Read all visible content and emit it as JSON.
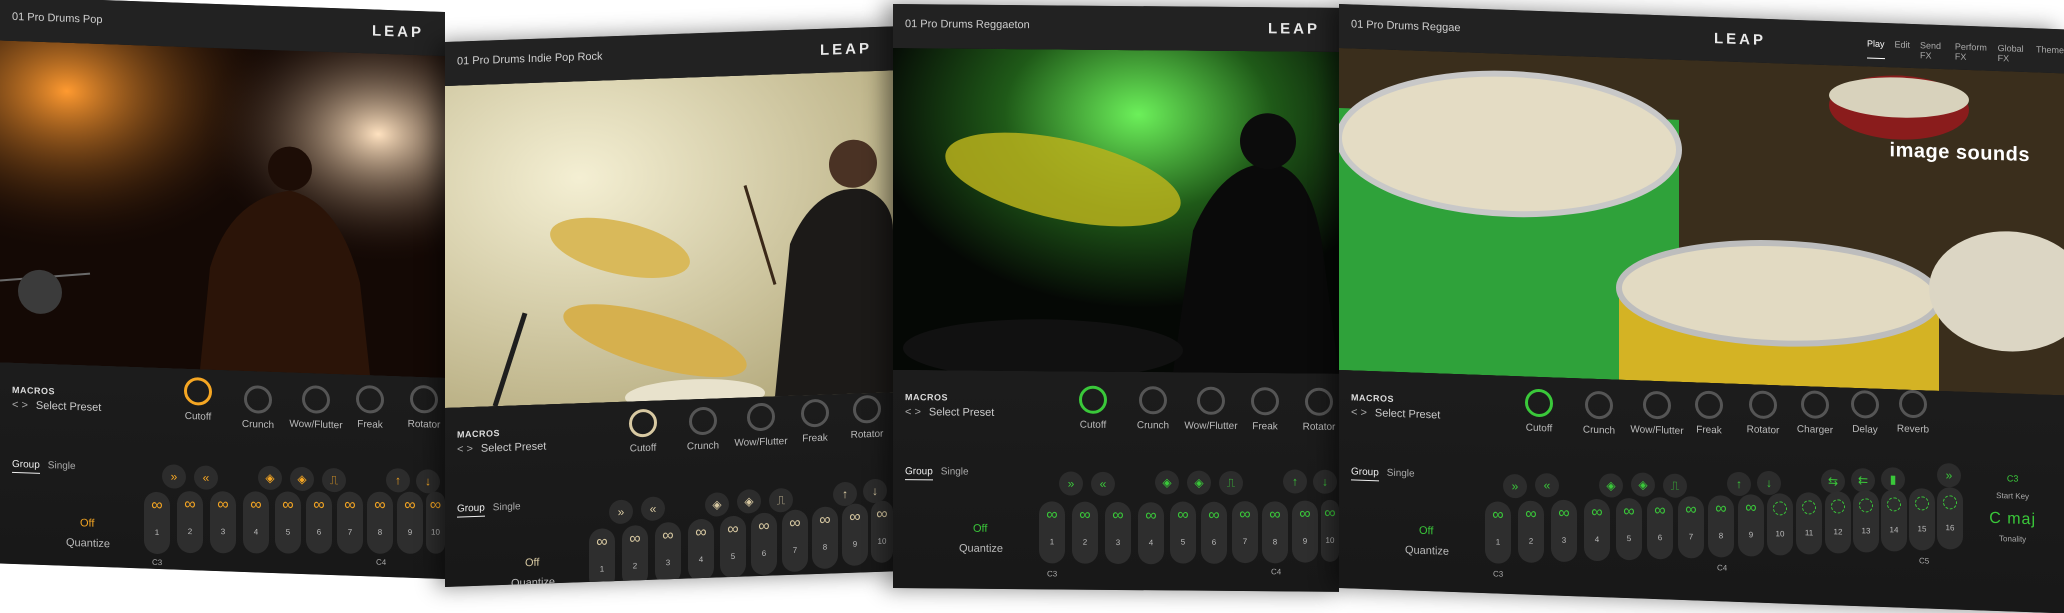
{
  "colors": {
    "orange": "#f5a623",
    "cream": "#d8c9a2",
    "green": "#3ac83a"
  },
  "shared": {
    "logo": "LEAP",
    "macros_title": "MACROS",
    "select_preset": "Select Preset",
    "preset_arrows": "< >",
    "group": "Group",
    "single": "Single",
    "off": "Off",
    "quantize": "Quantize",
    "c3": "C3",
    "c4": "C4",
    "c5": "C5"
  },
  "panels": [
    {
      "preset_name": "01 Pro Drums Pop",
      "knobs": [
        "Cutoff",
        "Crunch",
        "Wow/Flutter",
        "Freak",
        "Rotator"
      ],
      "pad_numbers": [
        "1",
        "2",
        "3",
        "4",
        "5",
        "6",
        "7",
        "8",
        "9",
        "10"
      ]
    },
    {
      "preset_name": "01 Pro Drums Indie Pop Rock",
      "knobs": [
        "Cutoff",
        "Crunch",
        "Wow/Flutter",
        "Freak",
        "Rotator"
      ],
      "pad_numbers": [
        "1",
        "2",
        "3",
        "4",
        "5",
        "6",
        "7",
        "8",
        "9",
        "10"
      ]
    },
    {
      "preset_name": "01 Pro Drums Reggaeton",
      "knobs": [
        "Cutoff",
        "Crunch",
        "Wow/Flutter",
        "Freak",
        "Rotator"
      ],
      "pad_numbers": [
        "1",
        "2",
        "3",
        "4",
        "5",
        "6",
        "7",
        "8",
        "9",
        "10"
      ]
    },
    {
      "preset_name": "01 Pro Drums Reggae",
      "brand": "image sounds",
      "nav_tabs": [
        "Play",
        "Edit",
        "Send FX",
        "Perform FX",
        "Global FX",
        "Theme"
      ],
      "knobs": [
        "Cutoff",
        "Crunch",
        "Wow/Flutter",
        "Freak",
        "Rotator",
        "Charger",
        "Delay",
        "Reverb"
      ],
      "pad_numbers": [
        "1",
        "2",
        "3",
        "4",
        "5",
        "6",
        "7",
        "8",
        "9",
        "10",
        "11",
        "12",
        "13",
        "14",
        "15",
        "16"
      ],
      "key": {
        "root_note": "C3",
        "start_key_label": "Start Key",
        "scale": "C  maj",
        "tonality_label": "Tonality"
      }
    }
  ]
}
